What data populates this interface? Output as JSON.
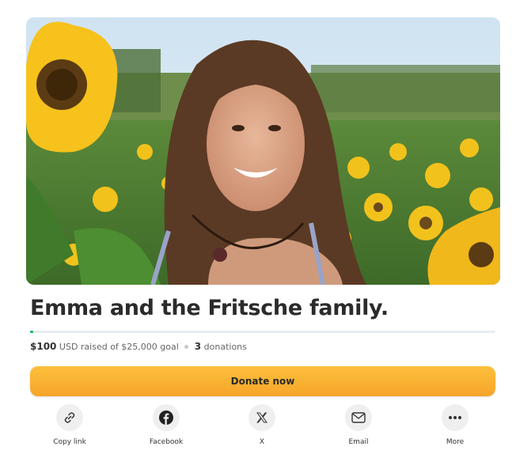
{
  "campaign": {
    "title": "Emma and the Fritsche family.",
    "raised_amount": "$100",
    "raised_rest": "USD raised of $25,000 goal",
    "donation_count": "3",
    "donation_label": "donations",
    "progress_fraction": 0.004
  },
  "actions": {
    "donate_label": "Donate now"
  },
  "share": {
    "items": [
      {
        "label": "Copy link",
        "icon": "link-icon"
      },
      {
        "label": "Facebook",
        "icon": "facebook-icon"
      },
      {
        "label": "X",
        "icon": "x-icon"
      },
      {
        "label": "Email",
        "icon": "email-icon"
      },
      {
        "label": "More",
        "icon": "more-icon"
      }
    ]
  },
  "colors": {
    "accent_green": "#00b964",
    "donate_button": "#fbb034"
  }
}
